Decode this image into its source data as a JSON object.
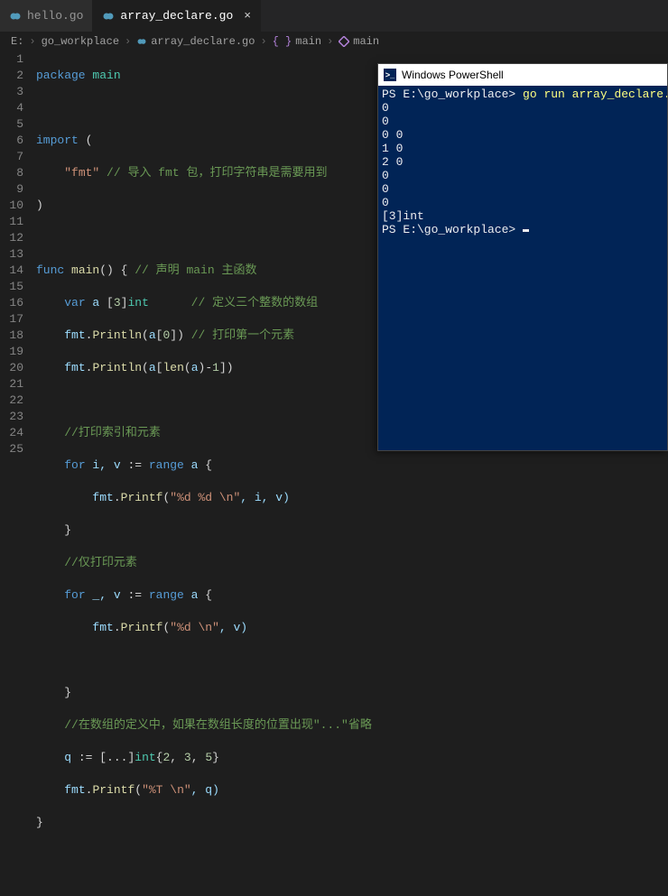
{
  "tabs": [
    {
      "label": "hello.go",
      "active": false
    },
    {
      "label": "array_declare.go",
      "active": true
    }
  ],
  "breadcrumbs": {
    "drive": "E:",
    "folder": "go_workplace",
    "file": "array_declare.go",
    "scope": "main",
    "symbol": "main"
  },
  "code": {
    "l1_kw": "package",
    "l1_pkg": " main",
    "l3_kw": "import",
    "l3_open": " (",
    "l4_str": "\"fmt\"",
    "l4_cmt": " // 导入 fmt 包，打印字符串是需要用到",
    "l5_close": ")",
    "l7_kw": "func",
    "l7_fn": " main",
    "l7_rest": "() {",
    "l7_cmt": " // 声明 main 主函数",
    "l8_kw": "var",
    "l8_id": " a",
    "l8_br": " [",
    "l8_num": "3",
    "l8_br2": "]",
    "l8_typ": "int",
    "l8_cmt": "      // 定义三个整数的数组",
    "l9_obj": "fmt",
    "l9_dot": ".",
    "l9_fn": "Println",
    "l9_open": "(",
    "l9_id": "a",
    "l9_idx": "[",
    "l9_num": "0",
    "l9_idx2": "])",
    "l9_cmt": " // 打印第一个元素",
    "l10_obj": "fmt",
    "l10_dot": ".",
    "l10_fn": "Println",
    "l10_open": "(",
    "l10_id": "a",
    "l10_idx": "[",
    "l10_fn2": "len",
    "l10_p": "(",
    "l10_id2": "a",
    "l10_p2": ")-",
    "l10_num": "1",
    "l10_end": "])",
    "l12_cmt": "//打印索引和元素",
    "l13_kw": "for",
    "l13_ids": " i, v ",
    "l13_op": ":=",
    "l13_kw2": " range ",
    "l13_id": "a",
    "l13_br": " {",
    "l14_obj": "fmt",
    "l14_dot": ".",
    "l14_fn": "Printf",
    "l14_open": "(",
    "l14_str": "\"%d %d \\n\"",
    "l14_rest": ", i, v)",
    "l15_close": "}",
    "l16_cmt": "//仅打印元素",
    "l17_kw": "for",
    "l17_ids": " _, v ",
    "l17_op": ":=",
    "l17_kw2": " range ",
    "l17_id": "a",
    "l17_br": " {",
    "l18_obj": "fmt",
    "l18_dot": ".",
    "l18_fn": "Printf",
    "l18_open": "(",
    "l18_str": "\"%d \\n\"",
    "l18_rest": ", v)",
    "l20_close": "}",
    "l21_cmt": "//在数组的定义中，如果在数组长度的位置出现\"...\"省略",
    "l22_id": "q",
    "l22_op": " := ",
    "l22_br": "[...]",
    "l22_typ": "int",
    "l22_lb": "{",
    "l22_n1": "2",
    "l22_c1": ", ",
    "l22_n2": "3",
    "l22_c2": ", ",
    "l22_n3": "5",
    "l22_rb": "}",
    "l23_obj": "fmt",
    "l23_dot": ".",
    "l23_fn": "Printf",
    "l23_open": "(",
    "l23_str": "\"%T \\n\"",
    "l23_rest": ", q)",
    "l24_close": "}"
  },
  "line_numbers": [
    "1",
    "2",
    "3",
    "4",
    "5",
    "6",
    "7",
    "8",
    "9",
    "10",
    "11",
    "12",
    "13",
    "14",
    "15",
    "16",
    "17",
    "18",
    "19",
    "20",
    "21",
    "22",
    "23",
    "24",
    "25"
  ],
  "powershell": {
    "title": "Windows PowerShell",
    "prompt1_path": "PS E:\\go_workplace>",
    "prompt1_cmd": " go run array_declare.go",
    "out": "0\n0\n0 0\n1 0\n2 0\n0\n0\n0\n[3]int",
    "prompt2_path": "PS E:\\go_workplace> "
  }
}
